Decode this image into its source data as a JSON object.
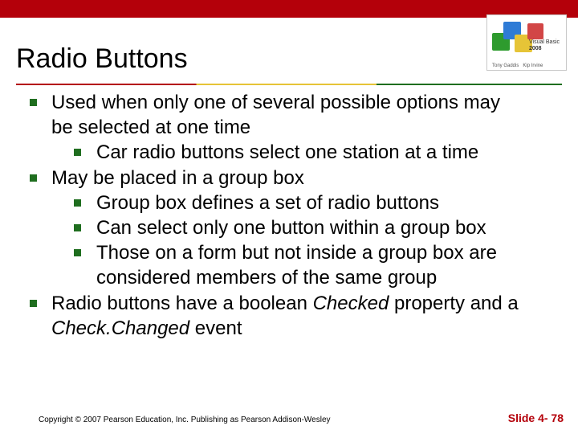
{
  "title": "Radio Buttons",
  "bullets": {
    "b1": "Used when only one of several possible options may be selected at one time",
    "b1a": "Car radio buttons select one station at a time",
    "b2": "May be placed in a group box",
    "b2a": "Group box defines a set of radio buttons",
    "b2b": "Can select only one button within a group box",
    "b2c": "Those on a form but not inside a group box are considered members of the same group",
    "b3_pre": "Radio buttons have a boolean ",
    "b3_i1": "Checked",
    "b3_mid": " property and a ",
    "b3_i2": "Check.Changed",
    "b3_post": " event"
  },
  "logo": {
    "line1": "Visual Basic",
    "line2": "2008"
  },
  "footer": {
    "copyright": "Copyright © 2007 Pearson Education, Inc. Publishing as Pearson Addison-Wesley",
    "slide": "Slide 4- 78"
  }
}
